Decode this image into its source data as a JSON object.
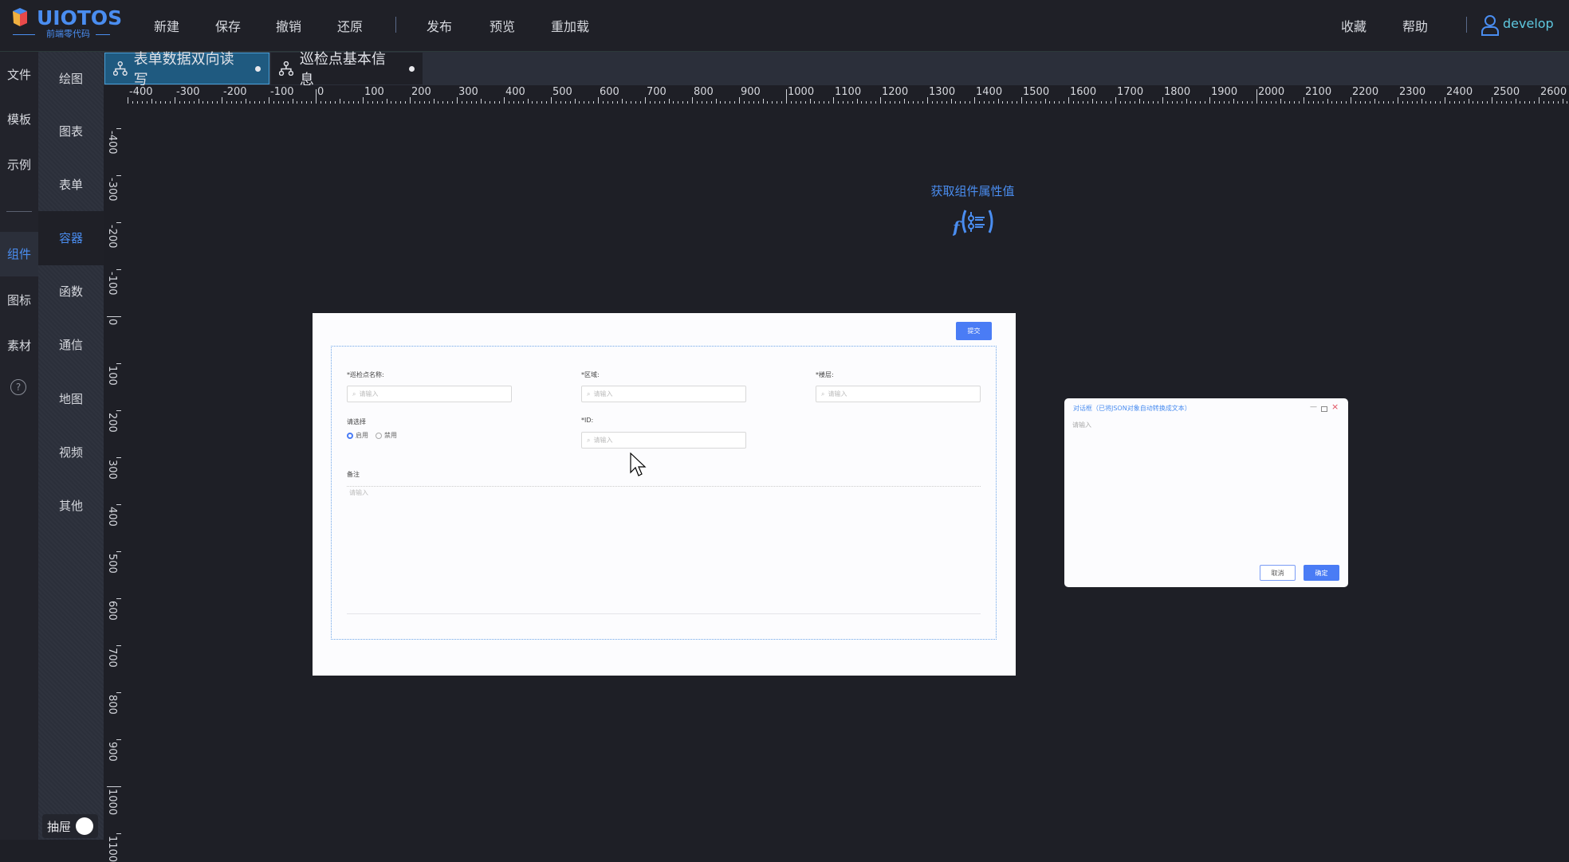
{
  "header": {
    "logo": "UIOTOS",
    "logo_sub": "前端零代码",
    "menu_left": [
      "新建",
      "保存",
      "撤销",
      "还原"
    ],
    "menu_mid": [
      "发布",
      "预览",
      "重加载"
    ],
    "menu_right": [
      "收藏",
      "帮助"
    ],
    "user": "develop"
  },
  "sidebar_main": {
    "items": [
      "文件",
      "模板",
      "示例",
      "组件",
      "图标",
      "素材"
    ],
    "active": "组件",
    "help": "?"
  },
  "sidebar_sub": {
    "items": [
      "绘图",
      "图表",
      "表单",
      "容器",
      "函数",
      "通信",
      "地图",
      "视频",
      "其他"
    ],
    "active": "容器",
    "drawer_label": "抽屉"
  },
  "tabs": [
    {
      "label": "表单数据双向读写",
      "selected": true
    },
    {
      "label": "巡检点基本信息",
      "selected": false
    }
  ],
  "ruler": {
    "h_labels": [
      -400,
      -300,
      -200,
      -100,
      0,
      100,
      200,
      300,
      400,
      500,
      600,
      700,
      800,
      900,
      1000,
      1100,
      1200,
      1300,
      1400,
      1500,
      1600,
      1700,
      1800,
      1900,
      2000,
      2100,
      2200,
      2300,
      2400,
      2500,
      2600
    ],
    "v_labels": [
      -400,
      -300,
      -200,
      -100,
      0,
      100,
      200,
      300,
      400,
      500,
      600,
      700,
      800,
      900,
      1000,
      1100
    ]
  },
  "canvas": {
    "function_node": {
      "label": "获取组件属性值",
      "icon": "function-icon"
    },
    "form": {
      "submit": "提交",
      "fields": [
        {
          "label": "*巡检点名称:",
          "placeholder": "请输入"
        },
        {
          "label": "*区域:",
          "placeholder": "请输入"
        },
        {
          "label": "*楼层:",
          "placeholder": "请输入"
        }
      ],
      "radio_label": "请选择",
      "radio_options": [
        "启用",
        "禁用"
      ],
      "radio_selected": "启用",
      "id_field": {
        "label": "*ID:",
        "placeholder": "请输入"
      },
      "remark": {
        "label": "备注",
        "placeholder": "请输入"
      }
    },
    "dialog": {
      "title": "对话框（已将JSON对象自动转换成文本）",
      "placeholder": "请输入",
      "cancel": "取消",
      "ok": "确定"
    }
  },
  "colors": {
    "accent": "#4a8df0",
    "button": "#4a7cf5",
    "background": "#1e1f26"
  }
}
